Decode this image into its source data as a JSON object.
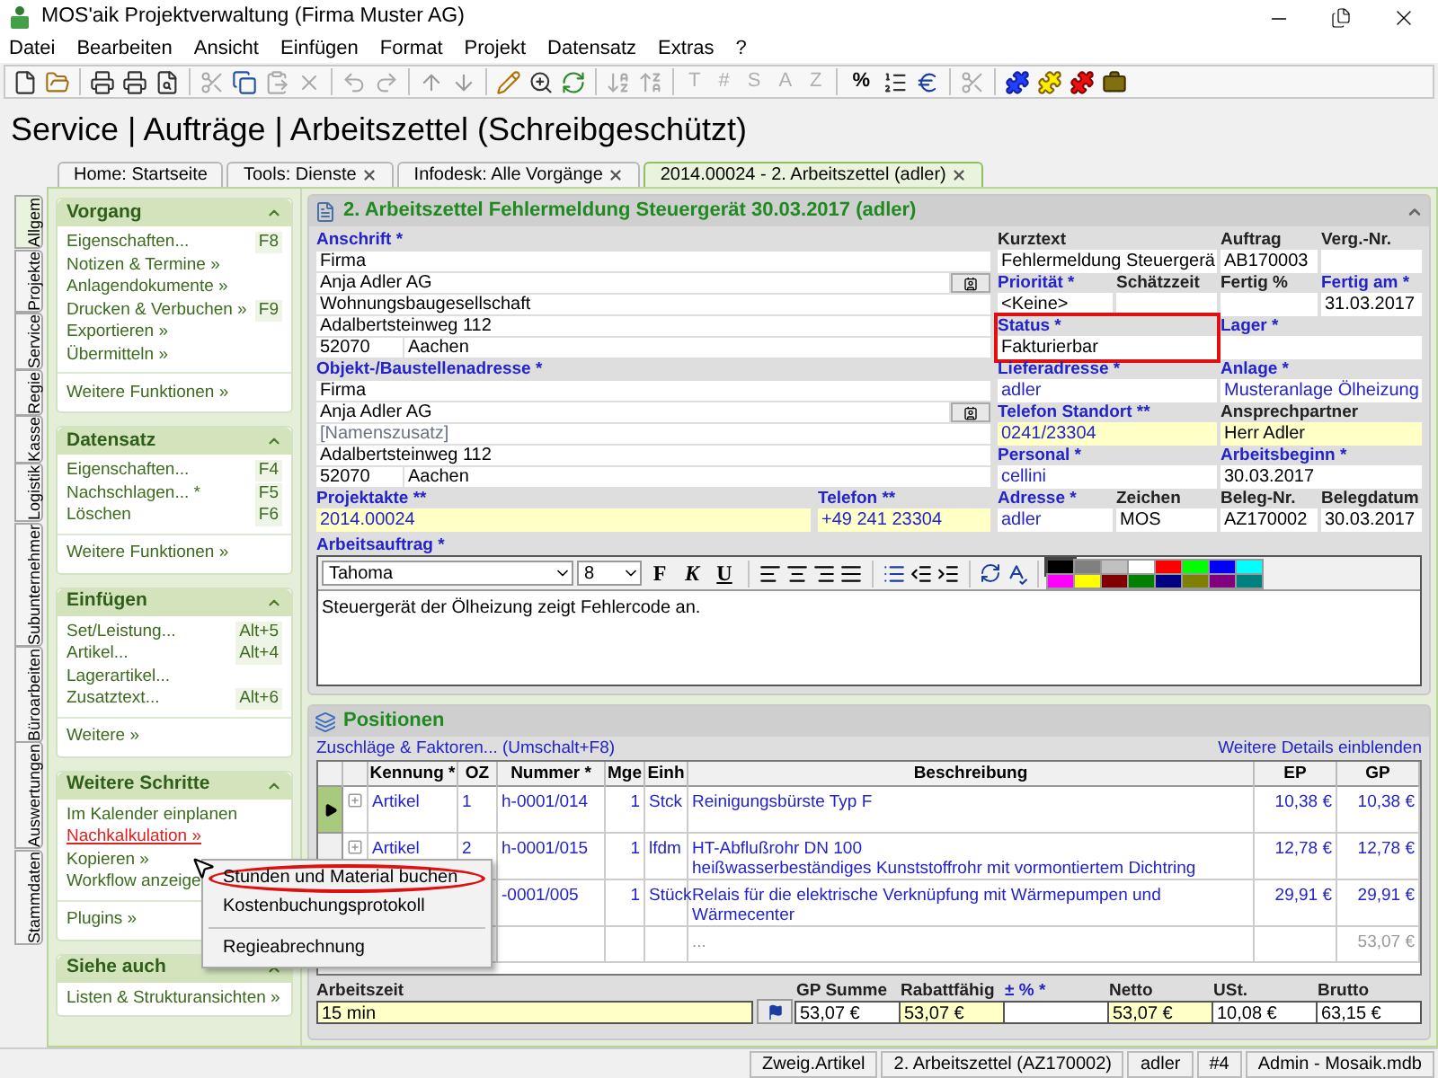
{
  "window": {
    "title": "MOS'aik Projektverwaltung (Firma Muster AG)"
  },
  "menu": [
    "Datei",
    "Bearbeiten",
    "Ansicht",
    "Einfügen",
    "Format",
    "Projekt",
    "Datensatz",
    "Extras",
    "?"
  ],
  "toolbar_glyphs": [
    {
      "label": "T",
      "disabled": true
    },
    {
      "label": "#",
      "disabled": true
    },
    {
      "label": "S",
      "disabled": true
    },
    {
      "label": "A",
      "disabled": true
    },
    {
      "label": "Z",
      "disabled": true
    },
    {
      "label": "%",
      "disabled": false
    }
  ],
  "page_title": "Service | Aufträge | Arbeitszettel (Schreibgeschützt)",
  "tabs": [
    {
      "label": "Home: Startseite",
      "selected": false,
      "closable": false
    },
    {
      "label": "Tools: Dienste",
      "selected": false,
      "closable": true
    },
    {
      "label": "Infodesk: Alle Vorgänge",
      "selected": false,
      "closable": true
    },
    {
      "label": "2014.00024 - 2. Arbeitszettel (adler)",
      "selected": true,
      "closable": true
    }
  ],
  "side_tabs": [
    {
      "label": "Allgem",
      "selected": true
    },
    {
      "label": "Projekte",
      "selected": false
    },
    {
      "label": "Service",
      "selected": false
    },
    {
      "label": "Regie",
      "selected": false
    },
    {
      "label": "Kasse",
      "selected": false
    },
    {
      "label": "Logistik",
      "selected": false
    },
    {
      "label": "Subunternehmer",
      "selected": false
    },
    {
      "label": "Büroarbeiten",
      "selected": false
    },
    {
      "label": "Auswertungen",
      "selected": false
    },
    {
      "label": "Stammdaten",
      "selected": false
    }
  ],
  "sidebar": [
    {
      "title": "Vorgang",
      "items": [
        {
          "label": "Eigenschaften...",
          "shortcut": "F8",
          "hot": false
        },
        {
          "label": "Notizen & Termine »",
          "hot": false
        },
        {
          "label": "Anlagendokumente »",
          "hot": false
        },
        {
          "label": "Drucken & Verbuchen »",
          "shortcut": "F9",
          "hot": false
        },
        {
          "label": "Exportieren »",
          "hot": false
        },
        {
          "label": "Übermitteln »",
          "hot": false
        }
      ],
      "footer": "Weitere Funktionen »"
    },
    {
      "title": "Datensatz",
      "items": [
        {
          "label": "Eigenschaften...",
          "shortcut": "F4",
          "hot": false
        },
        {
          "label": "Nachschlagen... *",
          "shortcut": "F5",
          "hot": false
        },
        {
          "label": "Löschen",
          "shortcut": "F6",
          "hot": false
        }
      ],
      "footer": "Weitere Funktionen »"
    },
    {
      "title": "Einfügen",
      "items": [
        {
          "label": "Set/Leistung...",
          "shortcut": "Alt+5",
          "hot": false
        },
        {
          "label": "Artikel...",
          "shortcut": "Alt+4",
          "hot": false
        },
        {
          "label": "Lagerartikel...",
          "hot": false
        },
        {
          "label": "Zusatztext...",
          "shortcut": "Alt+6",
          "hot": false
        }
      ],
      "footer": "Weitere »"
    },
    {
      "title": "Weitere Schritte",
      "items": [
        {
          "label": "Im Kalender einplanen",
          "hot": false
        },
        {
          "label": "Nachkalkulation »",
          "hot": true
        },
        {
          "label": "Kopieren »",
          "hot": false
        },
        {
          "label": "Workflow anzeige",
          "hot": false
        }
      ],
      "footer": "Plugins »"
    },
    {
      "title": "Siehe auch",
      "items": [
        {
          "label": "Listen & Strukturansichten »",
          "hot": false
        }
      ]
    }
  ],
  "context_menu": [
    {
      "label": "Stunden und Material buchen",
      "circled": true,
      "separator_before": false
    },
    {
      "label": "Kostenbuchungsprotokoll",
      "circled": false,
      "separator_before": false
    },
    {
      "label": "Regieabrechnung",
      "circled": false,
      "separator_before": true
    }
  ],
  "form": {
    "title": "2. Arbeitszettel Fehlermeldung Steuergerät 30.03.2017 (adler)",
    "address_blocks": [
      {
        "label": "Anschrift *",
        "linked": true,
        "lines": [
          {
            "value": "Firma"
          },
          {
            "value": "Anja Adler AG"
          },
          {
            "value": "Wohnungsbaugesellschaft"
          },
          {
            "value": "Adalbertsteinweg 112"
          }
        ],
        "postcode": "52070",
        "city": "Aachen"
      },
      {
        "label": "Objekt-/Baustellenadresse *",
        "linked": true,
        "lines": [
          {
            "value": "Firma"
          },
          {
            "value": "Anja Adler AG"
          },
          {
            "placeholder": "[Namenszusatz]"
          },
          {
            "value": "Adalbertsteinweg 112"
          }
        ],
        "postcode": "52070",
        "city": "Aachen"
      }
    ],
    "bottom_fields": [
      {
        "label": "Projektakte **",
        "value": "2014.00024",
        "linked": true,
        "value_linked": true,
        "highlighted": true,
        "flagged": false
      },
      {
        "label": "Telefon **",
        "value": "+49 241 23304",
        "linked": true,
        "value_linked": true,
        "highlighted": true,
        "flagged": false
      }
    ],
    "right_rows": [
      [
        {
          "label": "Kurztext",
          "value": "Fehlermeldung Steuergerä",
          "linked": false,
          "value_linked": false,
          "highlighted": false,
          "flagged": false
        },
        {
          "label": "Auftrag",
          "value": "AB170003",
          "linked": false,
          "value_linked": false,
          "highlighted": false,
          "flagged": false
        },
        {
          "label": "Verg.-Nr.",
          "linked": false,
          "highlighted": false,
          "flagged": false
        }
      ],
      [
        {
          "label": "Priorität *",
          "value": "<Keine>",
          "linked": true,
          "value_linked": false,
          "highlighted": false,
          "flagged": false
        },
        {
          "label": "Schätzzeit",
          "linked": false,
          "highlighted": false,
          "flagged": false
        },
        {
          "label": "Fertig %",
          "linked": false,
          "highlighted": false,
          "flagged": false
        },
        {
          "label": "Fertig am *",
          "value": "31.03.2017",
          "linked": true,
          "value_linked": false,
          "highlighted": false,
          "flagged": false
        }
      ],
      [
        {
          "label": "Status *",
          "value": "Fakturierbar",
          "linked": true,
          "value_linked": false,
          "highlighted": false,
          "flagged": true
        },
        {
          "label": "Lager *",
          "linked": true,
          "highlighted": false,
          "flagged": false
        }
      ],
      [
        {
          "label": "Lieferadresse *",
          "value": "adler",
          "linked": true,
          "value_linked": true,
          "highlighted": false,
          "flagged": false
        },
        {
          "label": "Anlage *",
          "value": "Musteranlage Ölheizung",
          "linked": true,
          "value_linked": true,
          "highlighted": false,
          "flagged": false
        }
      ],
      [
        {
          "label": "Telefon Standort **",
          "value": "0241/23304",
          "linked": true,
          "value_linked": true,
          "highlighted": true,
          "flagged": false
        },
        {
          "label": "Ansprechpartner",
          "value": "Herr Adler",
          "linked": false,
          "value_linked": false,
          "highlighted": true,
          "flagged": false
        }
      ],
      [
        {
          "label": "Personal *",
          "value": "cellini",
          "linked": true,
          "value_linked": true,
          "highlighted": false,
          "flagged": false
        },
        {
          "label": "Arbeitsbeginn *",
          "value": "30.03.2017",
          "linked": true,
          "value_linked": false,
          "highlighted": false,
          "flagged": false
        }
      ],
      [
        {
          "label": "Adresse *",
          "value": "adler",
          "linked": true,
          "value_linked": true,
          "highlighted": false,
          "flagged": false
        },
        {
          "label": "Zeichen",
          "value": "MOS",
          "linked": false,
          "value_linked": false,
          "highlighted": false,
          "flagged": false
        },
        {
          "label": "Beleg-Nr.",
          "value": "AZ170002",
          "linked": false,
          "value_linked": false,
          "highlighted": false,
          "flagged": false
        },
        {
          "label": "Belegdatum",
          "value": "30.03.2017",
          "linked": false,
          "value_linked": false,
          "highlighted": false,
          "flagged": false
        }
      ]
    ],
    "editor": {
      "label": "Arbeitsauftrag *",
      "linked": true,
      "font": "Tahoma",
      "size": "8",
      "format_buttons": [
        "F",
        "K",
        "U"
      ],
      "palette": [
        {
          "color": "#000000",
          "selected": true
        },
        {
          "color": "#808080",
          "selected": false
        },
        {
          "color": "#c0c0c0",
          "selected": false
        },
        {
          "color": "#ffffff",
          "selected": false
        },
        {
          "color": "#ff0000",
          "selected": false
        },
        {
          "color": "#00ff00",
          "selected": false
        },
        {
          "color": "#0000ff",
          "selected": false
        },
        {
          "color": "#00ffff",
          "selected": false
        },
        {
          "color": "#ff00ff",
          "selected": false
        },
        {
          "color": "#ffff00",
          "selected": false
        },
        {
          "color": "#800000",
          "selected": false
        },
        {
          "color": "#008000",
          "selected": false
        },
        {
          "color": "#000080",
          "selected": false
        },
        {
          "color": "#808000",
          "selected": false
        },
        {
          "color": "#800080",
          "selected": false
        },
        {
          "color": "#008080",
          "selected": false
        }
      ],
      "text": "Steuergerät der Ölheizung zeigt Fehlercode an."
    }
  },
  "positions": {
    "title": "Positionen",
    "surcharge_link": "Zuschläge & Faktoren... (Umschalt+F8)",
    "details_link": "Weitere Details einblenden",
    "columns": [
      "Kennung *",
      "OZ",
      "Nummer *",
      "Mge",
      "Einh",
      "Beschreibung",
      "EP",
      "GP"
    ],
    "rows": [
      {
        "kind": "item",
        "selected": true,
        "kennung": "Artikel",
        "oz": "1",
        "nummer": "h-0001/014",
        "mge": "1",
        "einh": "Stck",
        "beschreibung": [
          "Reinigungsbürste Typ F"
        ],
        "ep": "10,38 €",
        "gp": "10,38 €"
      },
      {
        "kind": "item",
        "selected": false,
        "kennung": "Artikel",
        "oz": "2",
        "nummer": "h-0001/015",
        "mge": "1",
        "einh": "lfdm",
        "beschreibung": [
          "HT-Abflußrohr DN 100",
          "heißwasserbeständiges Kunststoffrohr mit vormontiertem Dichtring"
        ],
        "ep": "12,78 €",
        "gp": "12,78 €"
      },
      {
        "kind": "item",
        "nummer": "-0001/005",
        "mge": "1",
        "einh": "Stück",
        "beschreibung": [
          "Relais für die elektrische Verknüpfung mit Wärmepumpen und Wärmecenter"
        ],
        "ep": "29,91 €",
        "gp": "29,91 €"
      },
      {
        "kind": "summary",
        "beschreibung": [
          "..."
        ],
        "gp": "53,07 €"
      }
    ],
    "totals": {
      "worktime": {
        "label": "Arbeitszeit",
        "value": "15 min",
        "highlighted": true
      },
      "amounts": [
        {
          "label": "GP Summe",
          "value": "53,07 €",
          "linked": false,
          "highlighted": false
        },
        {
          "label": "Rabattfähig",
          "value": "53,07 €",
          "linked": false,
          "highlighted": true
        },
        {
          "label": "± % *",
          "linked": true,
          "highlighted": false
        },
        {
          "label": "Netto",
          "value": "53,07 €",
          "linked": false,
          "highlighted": true
        },
        {
          "label": "USt.",
          "value": "10,08 €",
          "linked": false,
          "highlighted": false
        },
        {
          "label": "Brutto",
          "value": "63,15 €",
          "linked": false,
          "highlighted": false
        }
      ]
    }
  },
  "status_bar": [
    "Zweig.Artikel",
    "2. Arbeitszettel (AZ170002)",
    "adler",
    "#4",
    "Admin - Mosaik.mdb"
  ]
}
